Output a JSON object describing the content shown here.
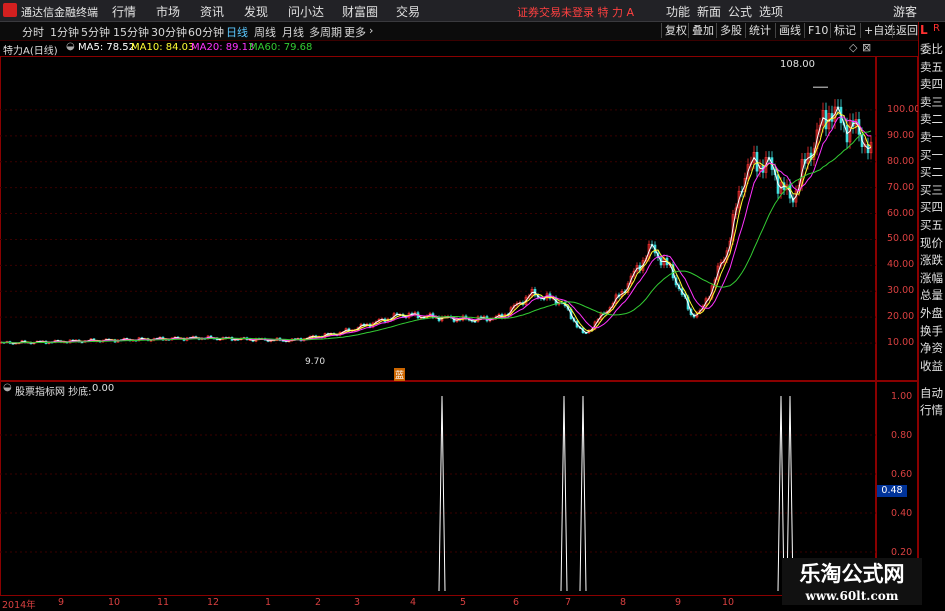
{
  "menubar": {
    "brand": "通达信金融终端",
    "menus": [
      "行情",
      "市场",
      "资讯",
      "发现",
      "问小达",
      "财富圈",
      "交易"
    ],
    "alert": "证券交易未登录 特 力 A",
    "right": [
      "功能",
      "新面",
      "公式",
      "选项"
    ],
    "guest": "游客"
  },
  "toolbar": {
    "periods": [
      "分时",
      "1分钟",
      "5分钟",
      "15分钟",
      "30分钟",
      "60分钟",
      "日线",
      "周线",
      "月线",
      "多周期",
      "更多"
    ],
    "active_period": "日线",
    "buttons": [
      "复权",
      "叠加",
      "多股",
      "统计",
      "画线",
      "F10",
      "标记",
      "+自选",
      "返回"
    ]
  },
  "info": {
    "stock": "特力A(日线)",
    "ma5": "MA5: 78.52",
    "ma10": "MA10: 84.03",
    "ma20": "MA20: 89.13",
    "ma60": "MA60: 79.68"
  },
  "colors": {
    "ma5": "#ffffff",
    "ma10": "#ffff33",
    "ma20": "#ff33ff",
    "ma60": "#33cc33",
    "up": "#ff3030",
    "down": "#40e0e0",
    "frame": "#8a0000"
  },
  "price_axis": [
    "100.00",
    "90.00",
    "80.00",
    "70.00",
    "60.00",
    "50.00",
    "40.00",
    "30.00",
    "20.00",
    "10.00"
  ],
  "price_axis_values": [
    100,
    90,
    80,
    70,
    60,
    50,
    40,
    30,
    20,
    10
  ],
  "annotations": {
    "high": "108.00",
    "low": "9.70",
    "marker": "蓝"
  },
  "indicator": {
    "label": "股票指标网 抄底:",
    "value": "0.00",
    "axis": [
      "1.00",
      "0.80",
      "0.60",
      "0.40",
      "0.20"
    ],
    "current": "0.48"
  },
  "side_panel": [
    "委比",
    "卖五",
    "卖四",
    "卖三",
    "卖二",
    "卖一",
    "买一",
    "买二",
    "买三",
    "买四",
    "买五",
    "现价",
    "涨跌",
    "涨幅",
    "总量",
    "外盘",
    "换手",
    "净资",
    "收益"
  ],
  "side_panel_bottom": [
    "自动",
    "行情"
  ],
  "side_markers": [
    "L",
    "R"
  ],
  "x_axis": {
    "year": "2014年",
    "labels": [
      "9",
      "10",
      "11",
      "12",
      "1",
      "2",
      "3",
      "4",
      "5",
      "6",
      "7",
      "8",
      "9",
      "10"
    ]
  },
  "watermark": {
    "title": "乐淘公式网",
    "url": "www.60lt.com"
  }
}
